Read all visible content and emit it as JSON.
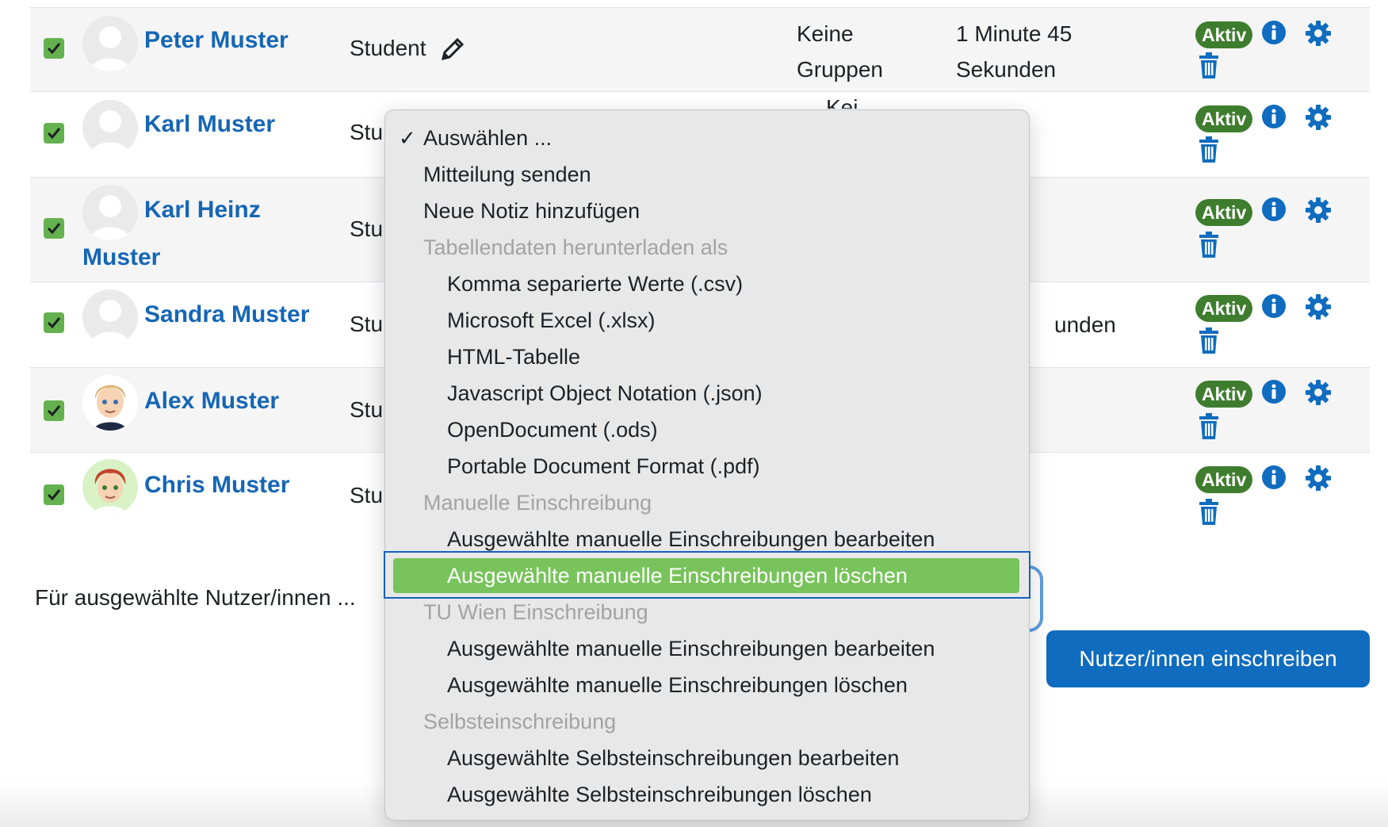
{
  "rows": [
    {
      "name_line1": "Peter Muster",
      "name_line2": "",
      "role": "Student",
      "groups": [
        "Keine",
        "Gruppen"
      ],
      "time": [
        "1 Minute 45",
        "Sekunden"
      ],
      "status": "Aktiv",
      "checked": true
    },
    {
      "name_line1": "Karl Muster",
      "name_line2": "",
      "role": "Stu",
      "groups": [
        "Kei"
      ],
      "time": [],
      "status": "Aktiv",
      "checked": true
    },
    {
      "name_line1": "Karl Heinz",
      "name_line2": "Muster",
      "role": "Stu",
      "groups": [],
      "time": [],
      "status": "Aktiv",
      "checked": true
    },
    {
      "name_line1": "Sandra Muster",
      "name_line2": "",
      "role": "Stu",
      "groups": [],
      "time": [
        "unden"
      ],
      "status": "Aktiv",
      "checked": true
    },
    {
      "name_line1": "Alex Muster",
      "name_line2": "",
      "role": "Stu",
      "groups": [],
      "time": [],
      "status": "Aktiv",
      "checked": true
    },
    {
      "name_line1": "Chris Muster",
      "name_line2": "",
      "role": "Stu",
      "groups": [],
      "time": [],
      "status": "Aktiv",
      "checked": true
    }
  ],
  "bulk": {
    "label": "Für ausgewählte Nutzer/innen ...",
    "enrol_button": "Nutzer/innen einschreiben"
  },
  "menu": {
    "selected_check": "✓",
    "items": [
      {
        "label": "Auswählen ...",
        "kind": "checked"
      },
      {
        "label": "Mitteilung senden",
        "kind": "option"
      },
      {
        "label": "Neue Notiz hinzufügen",
        "kind": "option"
      },
      {
        "label": "Tabellendaten herunterladen als",
        "kind": "group"
      },
      {
        "label": "Komma separierte Werte (.csv)",
        "kind": "indent"
      },
      {
        "label": "Microsoft Excel (.xlsx)",
        "kind": "indent"
      },
      {
        "label": "HTML-Tabelle",
        "kind": "indent"
      },
      {
        "label": "Javascript Object Notation (.json)",
        "kind": "indent"
      },
      {
        "label": "OpenDocument (.ods)",
        "kind": "indent"
      },
      {
        "label": "Portable Document Format (.pdf)",
        "kind": "indent"
      },
      {
        "label": "Manuelle Einschreibung",
        "kind": "group"
      },
      {
        "label": "Ausgewählte manuelle Einschreibungen bearbeiten",
        "kind": "indent"
      },
      {
        "label": "Ausgewählte manuelle Einschreibungen löschen",
        "kind": "highlighted"
      },
      {
        "label": "TU Wien Einschreibung",
        "kind": "group"
      },
      {
        "label": "Ausgewählte manuelle Einschreibungen bearbeiten",
        "kind": "indent"
      },
      {
        "label": "Ausgewählte manuelle Einschreibungen löschen",
        "kind": "indent"
      },
      {
        "label": "Selbsteinschreibung",
        "kind": "group"
      },
      {
        "label": "Ausgewählte Selbsteinschreibungen bearbeiten",
        "kind": "indent"
      },
      {
        "label": "Ausgewählte Selbsteinschreibungen löschen",
        "kind": "indent"
      }
    ]
  },
  "colors": {
    "link": "#1566b5",
    "badge": "#3f7d2e",
    "checkbox": "#64b14f",
    "highlight": "#78c35b",
    "button": "#0f6cbf"
  },
  "icons": {
    "checkbox": "checkbox-checked-icon",
    "edit": "pencil-icon",
    "info": "info-icon",
    "settings": "gear-icon",
    "delete": "trash-icon"
  }
}
